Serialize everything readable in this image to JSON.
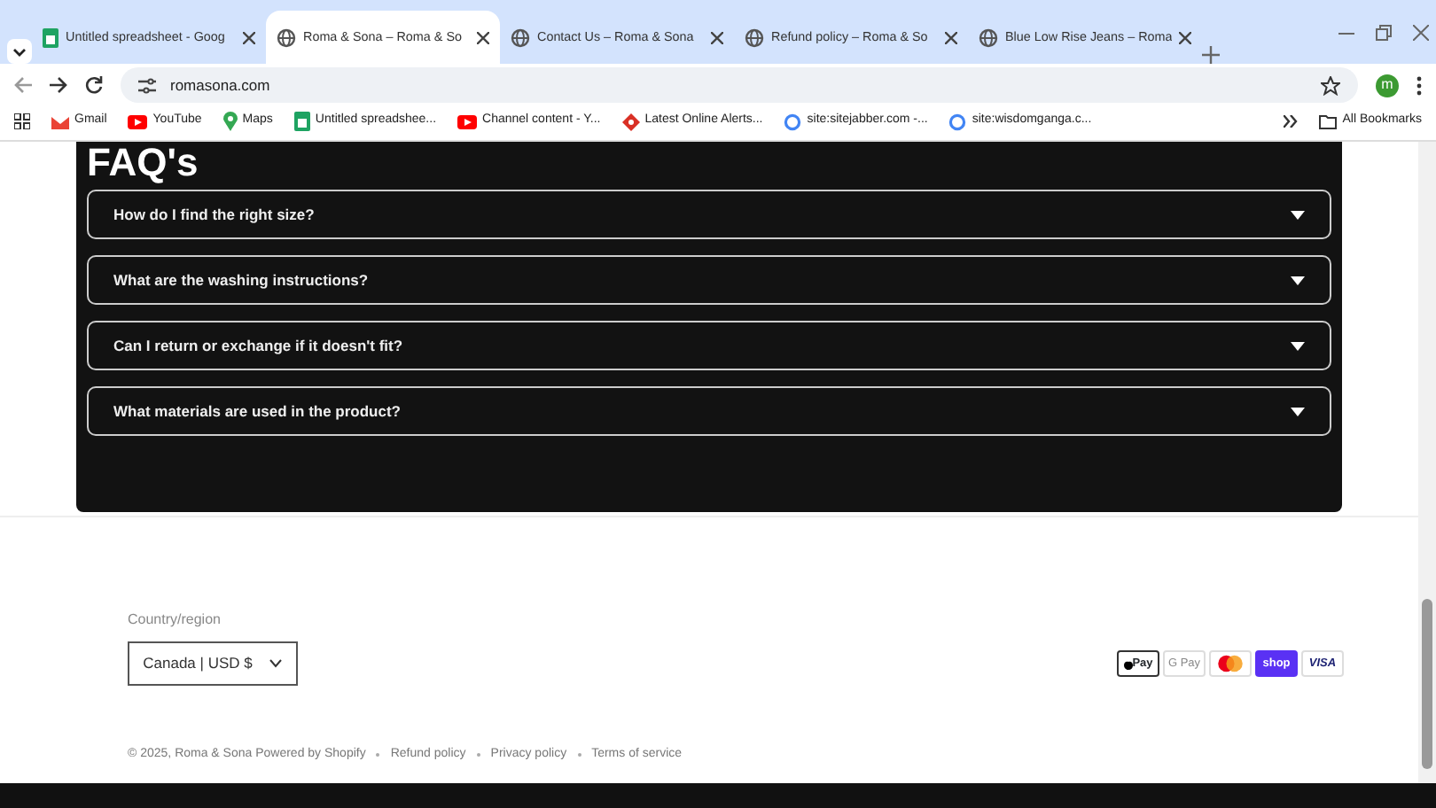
{
  "browser": {
    "tabs": [
      {
        "title": "Untitled spreadsheet - Goog",
        "kind": "sheet",
        "selected": false
      },
      {
        "title": "Roma & Sona – Roma & So",
        "kind": "globe",
        "selected": true
      },
      {
        "title": "Contact Us – Roma & Sona",
        "kind": "globe",
        "selected": false
      },
      {
        "title": "Refund policy – Roma & So",
        "kind": "globe",
        "selected": false
      },
      {
        "title": "Blue Low Rise Jeans – Roma",
        "kind": "globe",
        "selected": false
      }
    ],
    "address": "romasona.com",
    "profile_initial": "m",
    "bookmarks": [
      {
        "label": "Gmail",
        "kind": "gmail"
      },
      {
        "label": "YouTube",
        "kind": "youtube"
      },
      {
        "label": "Maps",
        "kind": "maps"
      },
      {
        "label": "Untitled spreadshee...",
        "kind": "sheet"
      },
      {
        "label": "Channel content - Y...",
        "kind": "youtube"
      },
      {
        "label": "Latest Online Alerts...",
        "kind": "alert"
      },
      {
        "label": "site:sitejabber.com -...",
        "kind": "google"
      },
      {
        "label": "site:wisdomganga.c...",
        "kind": "google"
      }
    ],
    "all_bookmarks": "All Bookmarks"
  },
  "faq": {
    "title": "FAQ's",
    "items": [
      {
        "question": "How do I find the right size?",
        "expanded": false
      },
      {
        "question": "What are the washing instructions?",
        "expanded": false
      },
      {
        "question": "Can I return or exchange if it doesn't fit?",
        "expanded": false
      },
      {
        "question": "What materials are used in the product?",
        "expanded": false
      }
    ]
  },
  "footer": {
    "country_label": "Country/region",
    "country_value": "Canada | USD $",
    "payments": [
      {
        "kind": "applepay",
        "label": "Pay"
      },
      {
        "kind": "gpay",
        "label": "G Pay"
      },
      {
        "kind": "mastercard"
      },
      {
        "kind": "shop",
        "label": "shop"
      },
      {
        "kind": "visa",
        "label": "VISA"
      }
    ],
    "copyright": "© 2025, Roma & Sona Powered by Shopify",
    "links": [
      "Refund policy",
      "Privacy policy",
      "Terms of service"
    ]
  }
}
